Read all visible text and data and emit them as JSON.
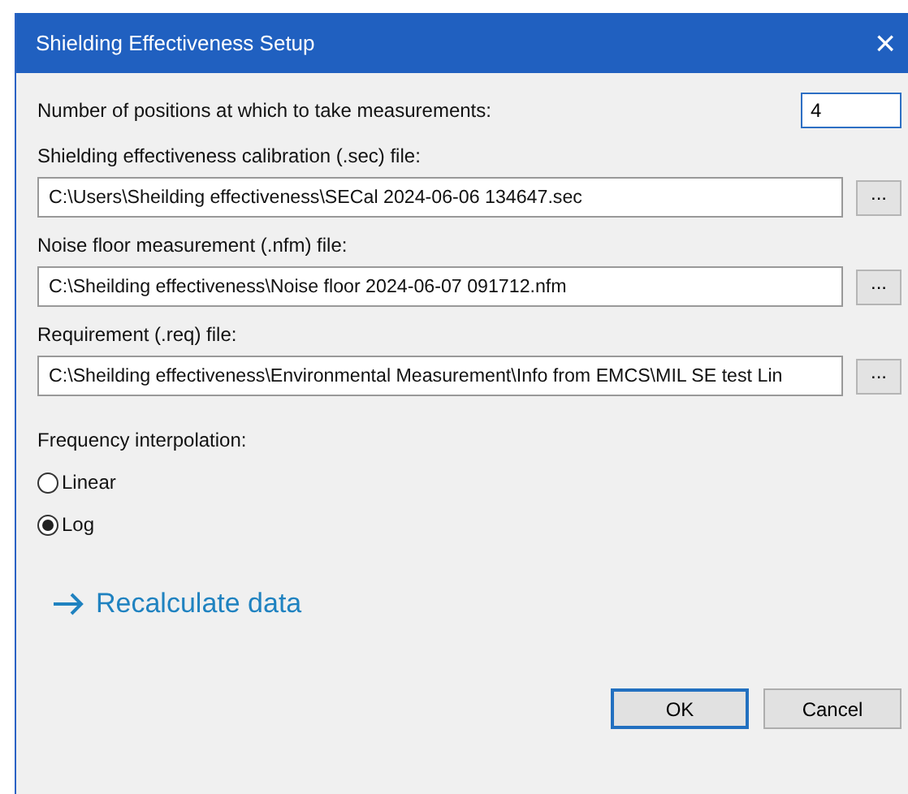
{
  "window": {
    "title": "Shielding Effectiveness Setup",
    "close": "×"
  },
  "positions": {
    "label": "Number of positions at which to take measurements:",
    "value": "4"
  },
  "files": [
    {
      "label": "Shielding effectiveness calibration (.sec) file:",
      "value": "C:\\Users\\Sheilding effectiveness\\SECal 2024-06-06 134647.sec",
      "browse": "..."
    },
    {
      "label": "Noise floor measurement (.nfm) file:",
      "value": "C:\\Sheilding effectiveness\\Noise floor 2024-06-07 091712.nfm",
      "browse": "..."
    },
    {
      "label": "Requirement (.req) file:",
      "value": "C:\\Sheilding effectiveness\\Environmental Measurement\\Info from EMCS\\MIL SE test Lin",
      "browse": "..."
    }
  ],
  "interpolation": {
    "label": "Frequency interpolation:",
    "options": [
      {
        "label": "Linear",
        "selected": false
      },
      {
        "label": "Log",
        "selected": true
      }
    ]
  },
  "recalculate": {
    "label": "Recalculate data"
  },
  "buttons": [
    {
      "label": "OK",
      "default": true
    },
    {
      "label": "Cancel",
      "default": false
    }
  ]
}
